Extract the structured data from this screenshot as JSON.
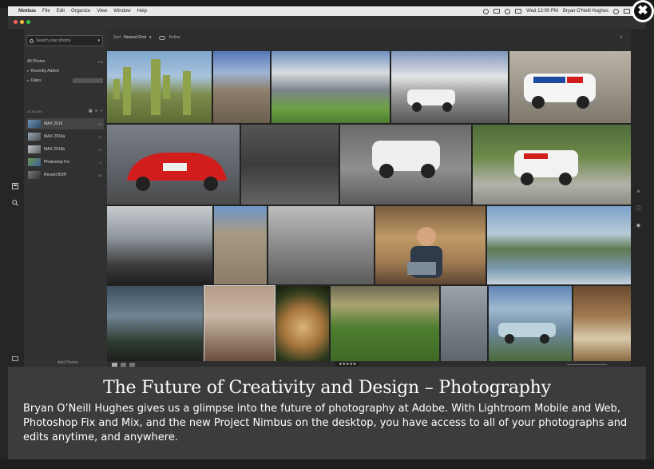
{
  "menubar": {
    "apple": "",
    "items": [
      "Nimbus",
      "File",
      "Edit",
      "Organize",
      "View",
      "Window",
      "Help"
    ],
    "clock": "Wed 12:00 PM",
    "user": "Bryan O'Neill Hughes"
  },
  "sidebar": {
    "search_placeholder": "Search your photos",
    "all_photos": "All Photos",
    "all_photos_count": "156",
    "recently_added": "Recently Added",
    "dates": "Dates",
    "albums_header": "ALBUMS",
    "albums": [
      {
        "name": "MAX 2016",
        "count": "36"
      },
      {
        "name": "MAX 2016a",
        "count": "21"
      },
      {
        "name": "MAX 2016b",
        "count": "25"
      },
      {
        "name": "Photoshop Fix",
        "count": "3"
      },
      {
        "name": "Recent BOH",
        "count": "68"
      }
    ],
    "add_photos": "Add Photos"
  },
  "toolbar": {
    "sort_label": "Sort",
    "sort_value": "Newest First",
    "refine": "Refine"
  },
  "status": {
    "rating_stars": "★★★★★"
  },
  "caption": {
    "title": "The Future of Creativity and Design – Photography",
    "description": "Bryan O’Neill Hughes gives us a glimpse into the future of photography at Adobe. With Lightroom Mobile and Web, Photoshop Fix and Mix, and the new Project Nimbus on the desktop, you have access to all of your photographs and edits anytime, and anywhere."
  },
  "close_icon": "✖",
  "colors": {
    "lightbox_bg": "#3c3c3c",
    "app_bg": "#2d2d2d",
    "accent_race_car": "#d21d1d"
  }
}
